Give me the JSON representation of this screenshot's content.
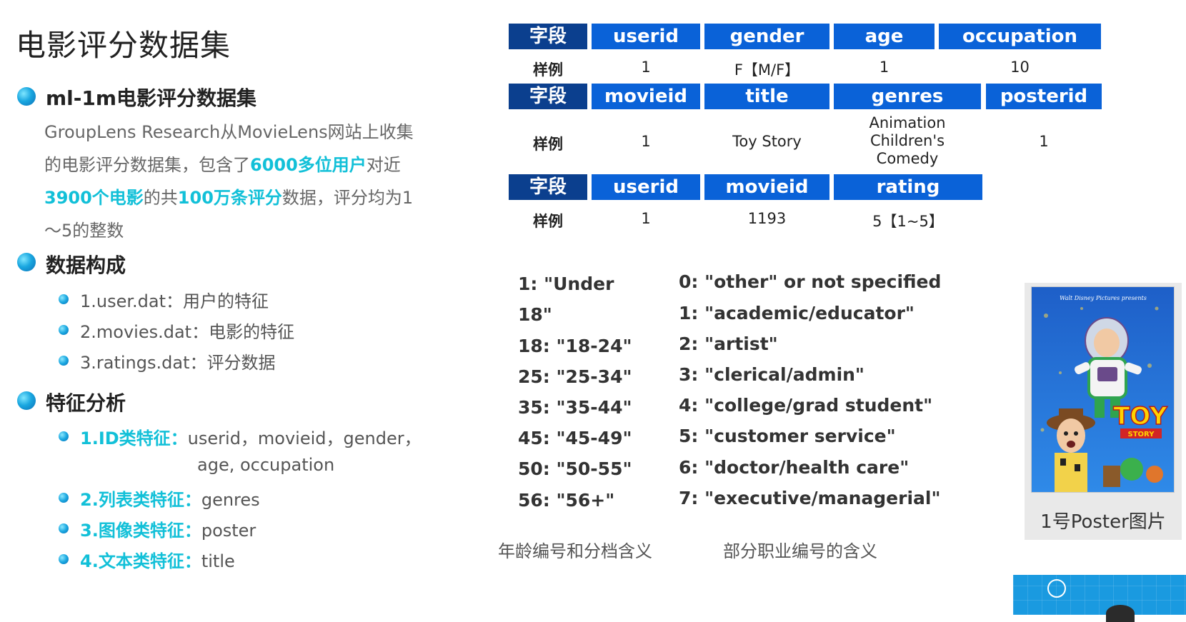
{
  "title": "电影评分数据集",
  "section1": {
    "heading": "ml-1m电影评分数据集",
    "para": {
      "t1": "GroupLens Research从MovieLens网站上收集的电影评分数据集，包含了",
      "h1": "6000多位用户",
      "t2": "对近",
      "h2": "3900个电影",
      "t3": "的共",
      "h3": "100万条评分",
      "t4": "数据，评分均为1～5的整数"
    }
  },
  "section2": {
    "heading": "数据构成",
    "items": [
      "1.user.dat：用户的特征",
      "2.movies.dat：电影的特征",
      "3.ratings.dat：评分数据"
    ]
  },
  "section3": {
    "heading": "特征分析",
    "items": [
      {
        "label": "1.ID类特征：",
        "text": "userid，movieid，gender，",
        "cont": "age, occupation"
      },
      {
        "label": "2.列表类特征：",
        "text": "genres"
      },
      {
        "label": "3.图像类特征：",
        "text": "poster"
      },
      {
        "label": "4.文本类特征：",
        "text": "title"
      }
    ]
  },
  "tables": {
    "field_label": "字段",
    "sample_label": "样例",
    "users": {
      "headers": [
        "userid",
        "gender",
        "age",
        "occupation"
      ],
      "sample": [
        "1",
        "F【M/F】",
        "1",
        "10"
      ]
    },
    "movies": {
      "headers": [
        "movieid",
        "title",
        "genres",
        "posterid"
      ],
      "sample": [
        "1",
        "Toy Story",
        "Animation\nChildren's\nComedy",
        "1"
      ]
    },
    "ratings": {
      "headers": [
        "userid",
        "movieid",
        "rating"
      ],
      "sample": [
        "1",
        "1193",
        "5【1~5】"
      ]
    }
  },
  "age_codes": [
    "1: \"Under",
    "18\"",
    "18: \"18-24\"",
    "25: \"25-34\"",
    "35: \"35-44\"",
    "45: \"45-49\"",
    "50: \"50-55\"",
    "56: \"56+\""
  ],
  "occupation_codes": [
    "0: \"other\" or not specified",
    "1: \"academic/educator\"",
    "2: \"artist\"",
    "3: \"clerical/admin\"",
    "4: \"college/grad student\"",
    "5: \"customer service\"",
    "6: \"doctor/health care\"",
    "7: \"executive/managerial\""
  ],
  "captions": {
    "age": "年龄编号和分档含义",
    "occupation": "部分职业编号的含义"
  },
  "poster": {
    "caption": "1号Poster图片",
    "logo_text": "Walt Disney Pictures presents",
    "title_text": "TOY",
    "subtitle_text": "STORY"
  },
  "colors": {
    "accent": "#12c0d8",
    "header_blue": "#0a62d8",
    "header_dark": "#0b3f8e"
  }
}
